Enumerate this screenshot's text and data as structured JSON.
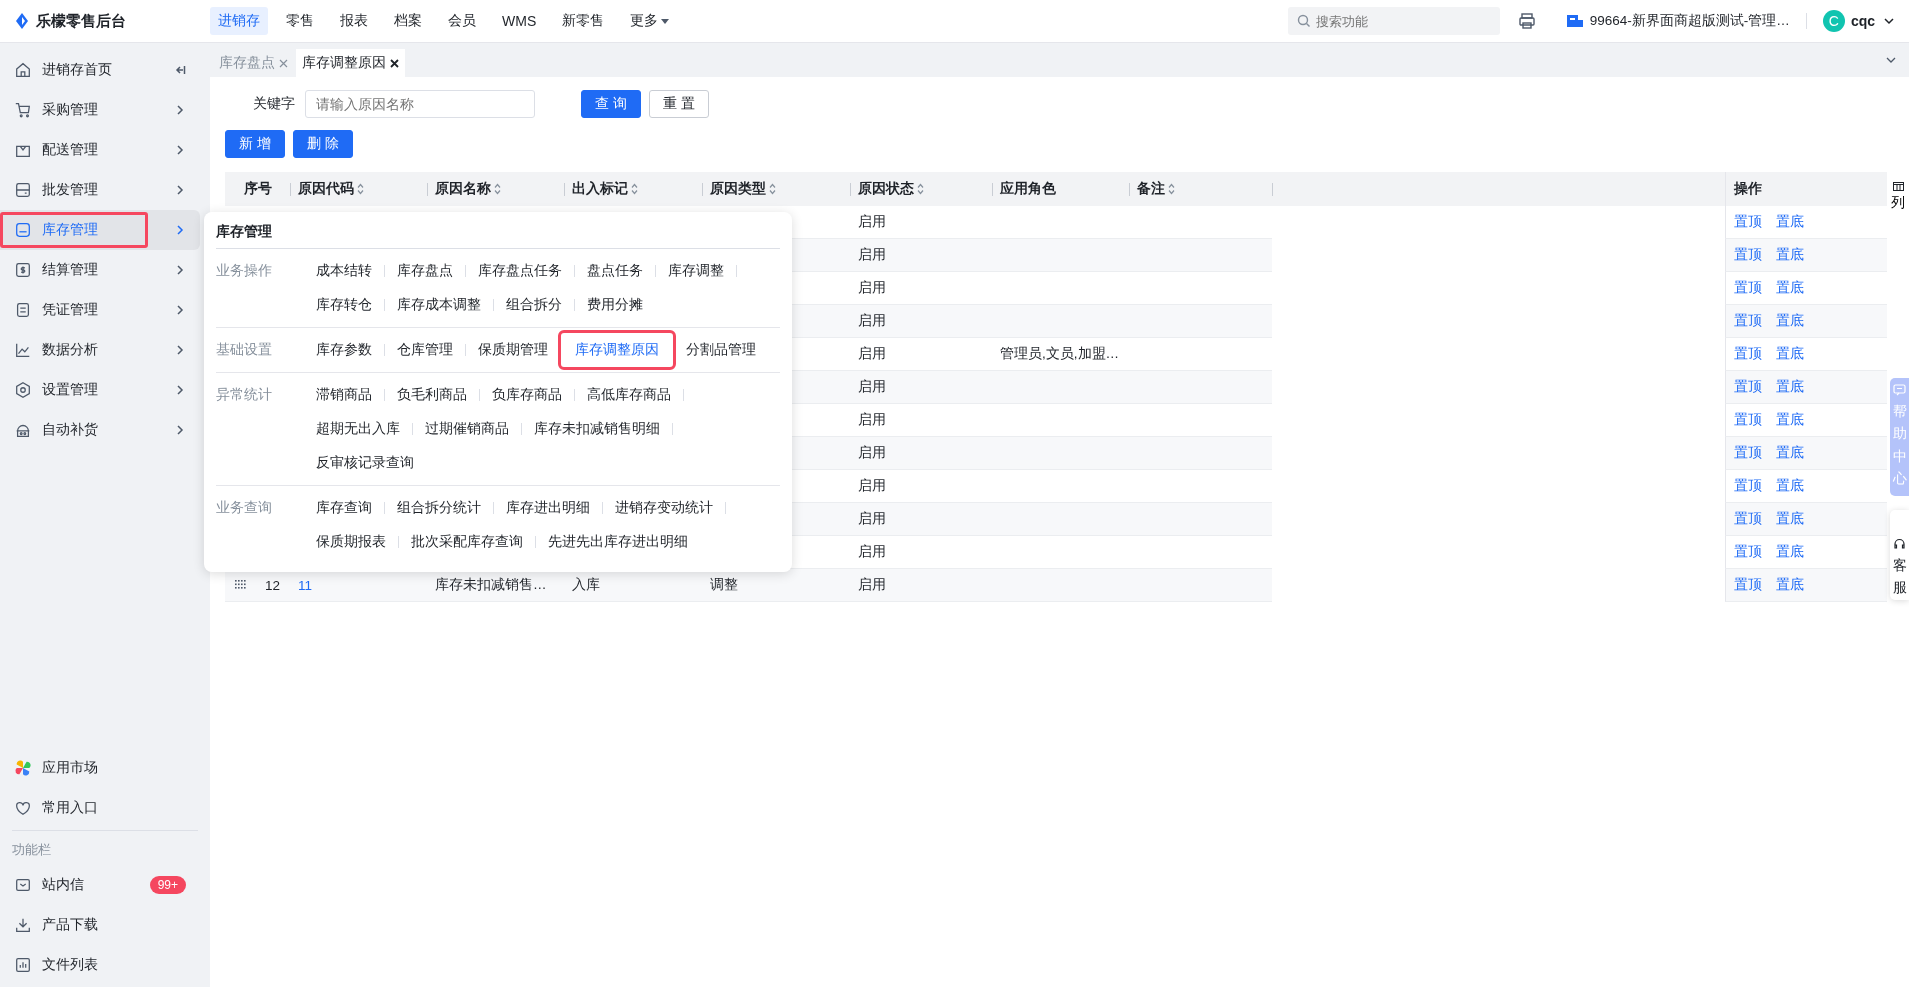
{
  "app": {
    "title": "乐檬零售后台"
  },
  "top_nav": [
    {
      "label": "进销存",
      "selected": true,
      "kind": "link"
    },
    {
      "label": "零售",
      "selected": false,
      "kind": "link"
    },
    {
      "label": "报表",
      "selected": false,
      "kind": "link"
    },
    {
      "label": "档案",
      "selected": false,
      "kind": "link"
    },
    {
      "label": "会员",
      "selected": false,
      "kind": "link"
    },
    {
      "label": "WMS",
      "selected": false,
      "kind": "link"
    },
    {
      "label": "新零售",
      "selected": false,
      "kind": "link"
    },
    {
      "label": "更多",
      "selected": false,
      "kind": "dropdown"
    }
  ],
  "search": {
    "placeholder": "搜索功能"
  },
  "store": {
    "label": "99664-新界面商超版测试-管理…"
  },
  "user": {
    "avatar": "C",
    "name": "cqc"
  },
  "sidebar": {
    "items": [
      {
        "label": "进销存首页",
        "kind": "home",
        "selected": false,
        "highlighted": false
      },
      {
        "label": "采购管理",
        "kind": "purchase",
        "selected": false,
        "highlighted": false
      },
      {
        "label": "配送管理",
        "kind": "delivery",
        "selected": false,
        "highlighted": false
      },
      {
        "label": "批发管理",
        "kind": "wholesale",
        "selected": false,
        "highlighted": false
      },
      {
        "label": "库存管理",
        "kind": "inventory",
        "selected": true,
        "highlighted": true
      },
      {
        "label": "结算管理",
        "kind": "settlement",
        "selected": false,
        "highlighted": false
      },
      {
        "label": "凭证管理",
        "kind": "voucher",
        "selected": false,
        "highlighted": false
      },
      {
        "label": "数据分析",
        "kind": "analysis",
        "selected": false,
        "highlighted": false
      },
      {
        "label": "设置管理",
        "kind": "settings",
        "selected": false,
        "highlighted": false
      },
      {
        "label": "自动补货",
        "kind": "replenish",
        "selected": false,
        "highlighted": false
      }
    ],
    "shortcuts": [
      {
        "label": "应用市场",
        "kind": "market"
      },
      {
        "label": "常用入口",
        "kind": "favorite"
      }
    ],
    "section_label": "功能栏",
    "tools": [
      {
        "label": "站内信",
        "kind": "message",
        "badge": "99+"
      },
      {
        "label": "产品下载",
        "kind": "download"
      },
      {
        "label": "文件列表",
        "kind": "files"
      }
    ]
  },
  "tabs": [
    {
      "label": "库存盘点",
      "selected": false
    },
    {
      "label": "库存调整原因",
      "selected": true
    }
  ],
  "filter": {
    "label": "关键字",
    "placeholder": "请输入原因名称",
    "buttons": [
      {
        "label": "查 询",
        "kind": "primary"
      },
      {
        "label": "重 置",
        "kind": "default"
      }
    ]
  },
  "actions": [
    {
      "label": "新 增",
      "kind": "primary"
    },
    {
      "label": "删 除",
      "kind": "primary"
    }
  ],
  "table": {
    "columns": [
      {
        "label": "序号",
        "sortable": false
      },
      {
        "label": "原因代码",
        "sortable": true
      },
      {
        "label": "原因名称",
        "sortable": true
      },
      {
        "label": "出入标记",
        "sortable": true
      },
      {
        "label": "原因类型",
        "sortable": true
      },
      {
        "label": "原因状态",
        "sortable": true
      },
      {
        "label": "应用角色",
        "sortable": false
      },
      {
        "label": "备注",
        "sortable": true
      }
    ],
    "actions_column": "操作",
    "column_settings": "列",
    "rows": [
      {
        "status": "启用",
        "actions": [
          "置顶",
          "置底"
        ]
      },
      {
        "status": "启用",
        "actions": [
          "置顶",
          "置底"
        ]
      },
      {
        "status": "启用",
        "actions": [
          "置顶",
          "置底"
        ]
      },
      {
        "status": "启用",
        "actions": [
          "置顶",
          "置底"
        ]
      },
      {
        "status": "启用",
        "role": "管理员,文员,加盟…",
        "actions": [
          "置顶",
          "置底"
        ]
      },
      {
        "status": "启用",
        "actions": [
          "置顶",
          "置底"
        ]
      },
      {
        "status": "启用",
        "actions": [
          "置顶",
          "置底"
        ]
      },
      {
        "status": "启用",
        "actions": [
          "置顶",
          "置底"
        ]
      },
      {
        "status": "启用",
        "actions": [
          "置顶",
          "置底"
        ]
      },
      {
        "status": "启用",
        "actions": [
          "置顶",
          "置底"
        ]
      },
      {
        "status": "启用",
        "actions": [
          "置顶",
          "置底"
        ]
      },
      {
        "seq": "12",
        "code": "11",
        "name": "库存未扣减销售…",
        "flag": "入库",
        "type": "调整",
        "status": "启用",
        "actions": [
          "置顶",
          "置底"
        ]
      }
    ]
  },
  "flyout": {
    "title": "库存管理",
    "sections": [
      {
        "label": "业务操作",
        "items": [
          {
            "label": "成本结转",
            "selected": false,
            "highlighted": false
          },
          {
            "label": "库存盘点",
            "selected": false,
            "highlighted": false
          },
          {
            "label": "库存盘点任务",
            "selected": false,
            "highlighted": false
          },
          {
            "label": "盘点任务",
            "selected": false,
            "highlighted": false
          },
          {
            "label": "库存调整",
            "selected": false,
            "highlighted": false
          },
          {
            "label": "库存转仓",
            "selected": false,
            "highlighted": false
          },
          {
            "label": "库存成本调整",
            "selected": false,
            "highlighted": false
          },
          {
            "label": "组合拆分",
            "selected": false,
            "highlighted": false
          },
          {
            "label": "费用分摊",
            "selected": false,
            "highlighted": false
          }
        ]
      },
      {
        "label": "基础设置",
        "items": [
          {
            "label": "库存参数",
            "selected": false,
            "highlighted": false
          },
          {
            "label": "仓库管理",
            "selected": false,
            "highlighted": false
          },
          {
            "label": "保质期管理",
            "selected": false,
            "highlighted": false
          },
          {
            "label": "库存调整原因",
            "selected": true,
            "highlighted": true
          },
          {
            "label": "分割品管理",
            "selected": false,
            "highlighted": false
          }
        ]
      },
      {
        "label": "异常统计",
        "items": [
          {
            "label": "滞销商品",
            "selected": false,
            "highlighted": false
          },
          {
            "label": "负毛利商品",
            "selected": false,
            "highlighted": false
          },
          {
            "label": "负库存商品",
            "selected": false,
            "highlighted": false
          },
          {
            "label": "高低库存商品",
            "selected": false,
            "highlighted": false
          },
          {
            "label": "超期无出入库",
            "selected": false,
            "highlighted": false
          },
          {
            "label": "过期催销商品",
            "selected": false,
            "highlighted": false
          },
          {
            "label": "库存未扣减销售明细",
            "selected": false,
            "highlighted": false
          },
          {
            "label": "反审核记录查询",
            "selected": false,
            "highlighted": false
          }
        ]
      },
      {
        "label": "业务查询",
        "items": [
          {
            "label": "库存查询",
            "selected": false,
            "highlighted": false
          },
          {
            "label": "组合拆分统计",
            "selected": false,
            "highlighted": false
          },
          {
            "label": "库存进出明细",
            "selected": false,
            "highlighted": false
          },
          {
            "label": "进销存变动统计",
            "selected": false,
            "highlighted": false
          },
          {
            "label": "保质期报表",
            "selected": false,
            "highlighted": false
          },
          {
            "label": "批次采配库存查询",
            "selected": false,
            "highlighted": false
          },
          {
            "label": "先进先出库存进出明细",
            "selected": false,
            "highlighted": false
          }
        ]
      }
    ]
  },
  "help": {
    "label": "帮助中心"
  },
  "service": {
    "label": "客服"
  }
}
